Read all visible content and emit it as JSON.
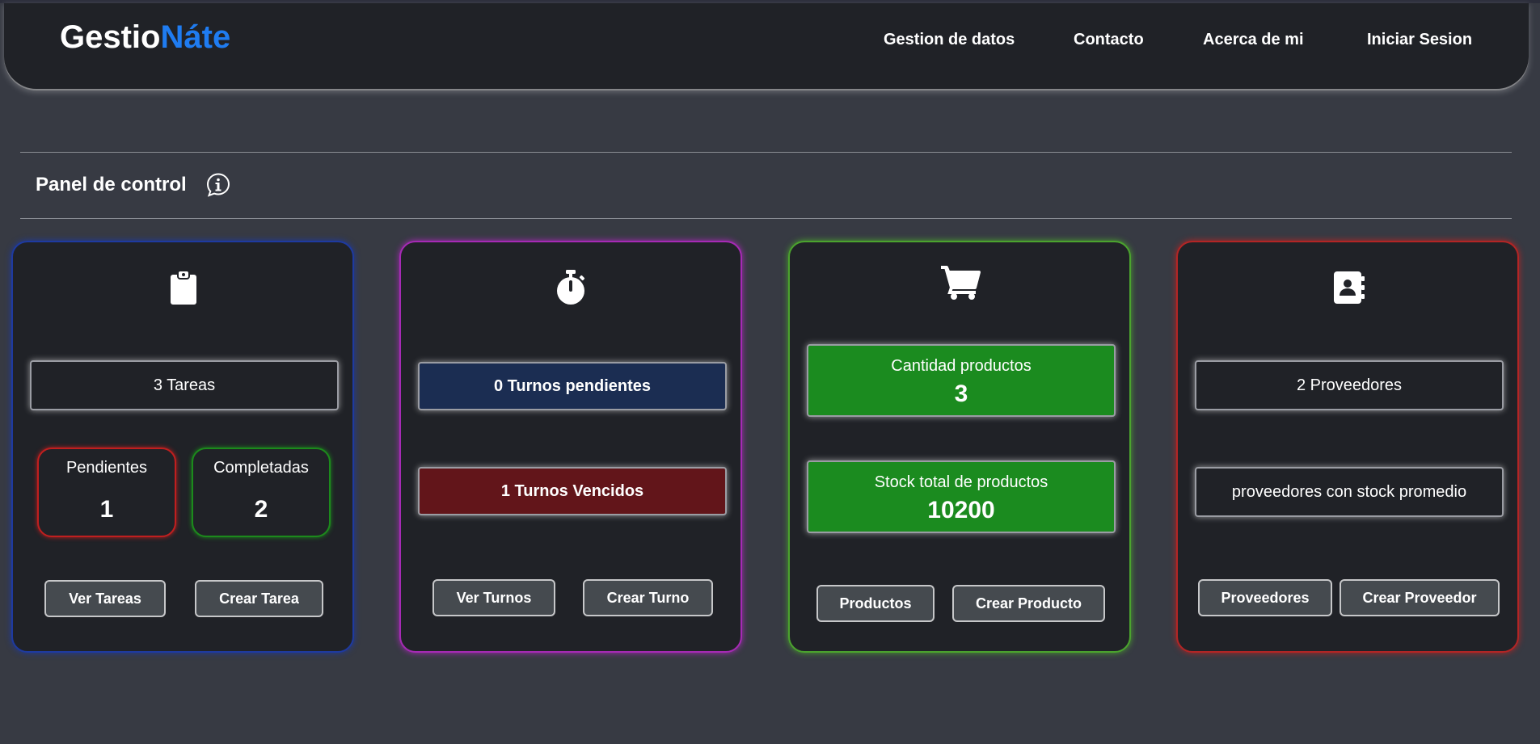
{
  "nav": {
    "logo_part1": "Gestio",
    "logo_part2": "Náte",
    "items": [
      "Gestion de datos",
      "Contacto",
      "Acerca de mi",
      "Iniciar Sesion"
    ]
  },
  "panel": {
    "title": "Panel de control",
    "info_icon": "info-chat-icon"
  },
  "cards": {
    "tareas": {
      "icon": "clipboard-icon",
      "total": "3 Tareas",
      "pending_label": "Pendientes",
      "pending_value": "1",
      "completed_label": "Completadas",
      "completed_value": "2",
      "btn_view": "Ver Tareas",
      "btn_create": "Crear Tarea"
    },
    "turnos": {
      "icon": "stopwatch-icon",
      "pending": "0 Turnos pendientes",
      "expired": "1 Turnos Vencidos",
      "btn_view": "Ver Turnos",
      "btn_create": "Crear Turno"
    },
    "productos": {
      "icon": "cart-icon",
      "qty_label": "Cantidad productos",
      "qty_value": "3",
      "stock_label": "Stock total de productos",
      "stock_value": "10200",
      "btn_view": "Productos",
      "btn_create": "Crear Producto"
    },
    "proveedores": {
      "icon": "contact-book-icon",
      "total": "2 Proveedores",
      "avg_stock": "proveedores con stock promedio",
      "btn_view": "Proveedores",
      "btn_create": "Crear Proveedor"
    }
  },
  "colors": {
    "background": "#373a43",
    "card": "#202227",
    "accent_blue": "#1f7cf1",
    "card_blue": "#1e3aa0",
    "card_purple": "#a62ab5",
    "card_green": "#4ba32e",
    "card_red": "#b32525",
    "stat_green": "#1b8b1f",
    "stat_navy": "#1b2d52",
    "stat_maroon": "#62151a"
  }
}
